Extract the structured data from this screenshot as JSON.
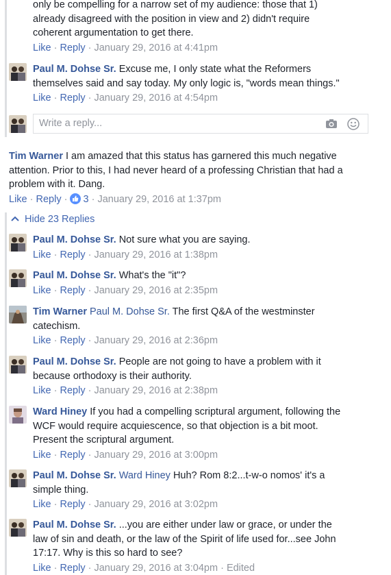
{
  "comments": [
    {
      "lines": [
        "only be compelling for a narrow set of my audience: those that 1)",
        "already disagreed with the position in view and 2) didn't require",
        "coherent argumentation to get there."
      ],
      "like": "Like",
      "reply": "Reply",
      "time": "January 29, 2016 at 4:41pm"
    },
    {
      "name": "Paul M. Dohse Sr.",
      "lines": [
        "Excuse me, I only state what the Reformers",
        "themselves said and say today. My only logic is, \"words mean things.\""
      ],
      "like": "Like",
      "reply": "Reply",
      "time": "January 29, 2016 at 4:54pm"
    },
    {
      "name": "Tim Warner",
      "lines": [
        "I am amazed that this status has garnered this much negative",
        "attention. Prior to this, I had never heard of a professing Christian that had a",
        "problem with it. Dang."
      ],
      "like": "Like",
      "reply": "Reply",
      "likes": "3",
      "time": "January 29, 2016 at 1:37pm"
    },
    {
      "name": "Paul M. Dohse Sr.",
      "lines": [
        "Not sure what you are saying."
      ],
      "like": "Like",
      "reply": "Reply",
      "time": "January 29, 2016 at 1:38pm"
    },
    {
      "name": "Paul M. Dohse Sr.",
      "lines": [
        "What's the \"it\"?"
      ],
      "like": "Like",
      "reply": "Reply",
      "time": "January 29, 2016 at 2:35pm"
    },
    {
      "name": "Tim Warner",
      "mention": "Paul M. Dohse Sr.",
      "lines": [
        "The first Q&A of the westminster",
        "catechism."
      ],
      "like": "Like",
      "reply": "Reply",
      "time": "January 29, 2016 at 2:36pm"
    },
    {
      "name": "Paul M. Dohse Sr.",
      "lines": [
        "People are not going to have a problem with it",
        "because orthodoxy is their authority."
      ],
      "like": "Like",
      "reply": "Reply",
      "time": "January 29, 2016 at 2:38pm"
    },
    {
      "name": "Ward Hiney",
      "lines": [
        "If you had a compelling scriptural argument, following the",
        "WCF would require acquiescence, so that objection is a bit moot.",
        "Present the scriptural argument."
      ],
      "like": "Like",
      "reply": "Reply",
      "time": "January 29, 2016 at 3:00pm"
    },
    {
      "name": "Paul M. Dohse Sr.",
      "mention": "Ward Hiney",
      "lines": [
        "Huh? Rom 8:2...t-w-o nomos' it's a",
        "simple thing."
      ],
      "like": "Like",
      "reply": "Reply",
      "time": "January 29, 2016 at 3:02pm"
    },
    {
      "name": "Paul M. Dohse Sr.",
      "lines": [
        "...you are either under law or grace, or under the",
        "law of sin and death, or the law of the Spirit of life used for...see John",
        "17:17. Why is this so hard to see?"
      ],
      "like": "Like",
      "reply": "Reply",
      "time": "January 29, 2016 at 3:04pm",
      "edited": "Edited"
    }
  ],
  "reply_box": {
    "placeholder": "Write a reply...",
    "icons": [
      "camera-icon",
      "smiley-icon"
    ]
  },
  "hide_replies": {
    "label": "Hide 23 Replies",
    "icon": "chevron-up-icon"
  },
  "colors": {
    "link": "#365899",
    "action": "#4267b2",
    "meta": "#90949c",
    "like_badge": "#5890ff"
  }
}
